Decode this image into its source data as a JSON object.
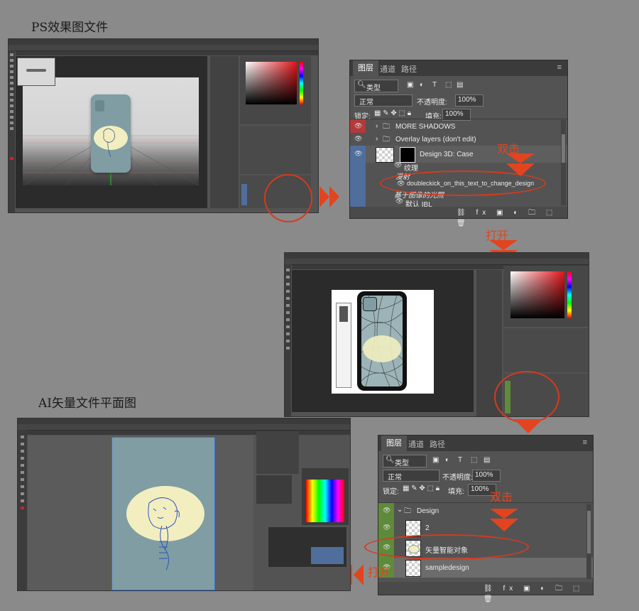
{
  "titles": {
    "ps_effect": "PS效果图文件",
    "ai_vector": "AI矢量文件平面图"
  },
  "annotations": {
    "double_click_1": "双击",
    "open_1": "打开",
    "double_click_2": "双击",
    "open_2": "打开"
  },
  "layers_panel_top": {
    "tabs": [
      "图层",
      "通道",
      "路径"
    ],
    "filter_kind": "类型",
    "blend_mode": "正常",
    "opacity_label": "不透明度:",
    "opacity_value": "100%",
    "lock_label": "锁定:",
    "fill_label": "填充:",
    "fill_value": "100%",
    "layers": [
      {
        "name": "MORE SHADOWS"
      },
      {
        "name": "Overlay layers (don't edit)"
      },
      {
        "name": "Design 3D: Case"
      },
      {
        "name": "纹理"
      },
      {
        "name": "漫射"
      },
      {
        "name": "doubleckick_on_this_text_to_change_design"
      },
      {
        "name": "基于图像的光照"
      },
      {
        "name": "默认 IBL"
      }
    ]
  },
  "layers_panel_bottom": {
    "tabs": [
      "图层",
      "通道",
      "路径"
    ],
    "filter_kind": "类型",
    "blend_mode": "正常",
    "opacity_label": "不透明度:",
    "opacity_value": "100%",
    "lock_label": "锁定:",
    "fill_label": "填充:",
    "fill_value": "100%",
    "layers": [
      {
        "name": "Design"
      },
      {
        "name": "2"
      },
      {
        "name": "矢量智能对象"
      },
      {
        "name": "sampledesign"
      }
    ]
  },
  "colors": {
    "background": "#8a8a8a",
    "ps_ui": "#535353",
    "case_teal": "#7f9da3",
    "oval_cream": "#f2eec0",
    "red_marker": "#e2441f",
    "layer_green": "#5f8a3a",
    "layer_blue": "#4f6e9c"
  }
}
